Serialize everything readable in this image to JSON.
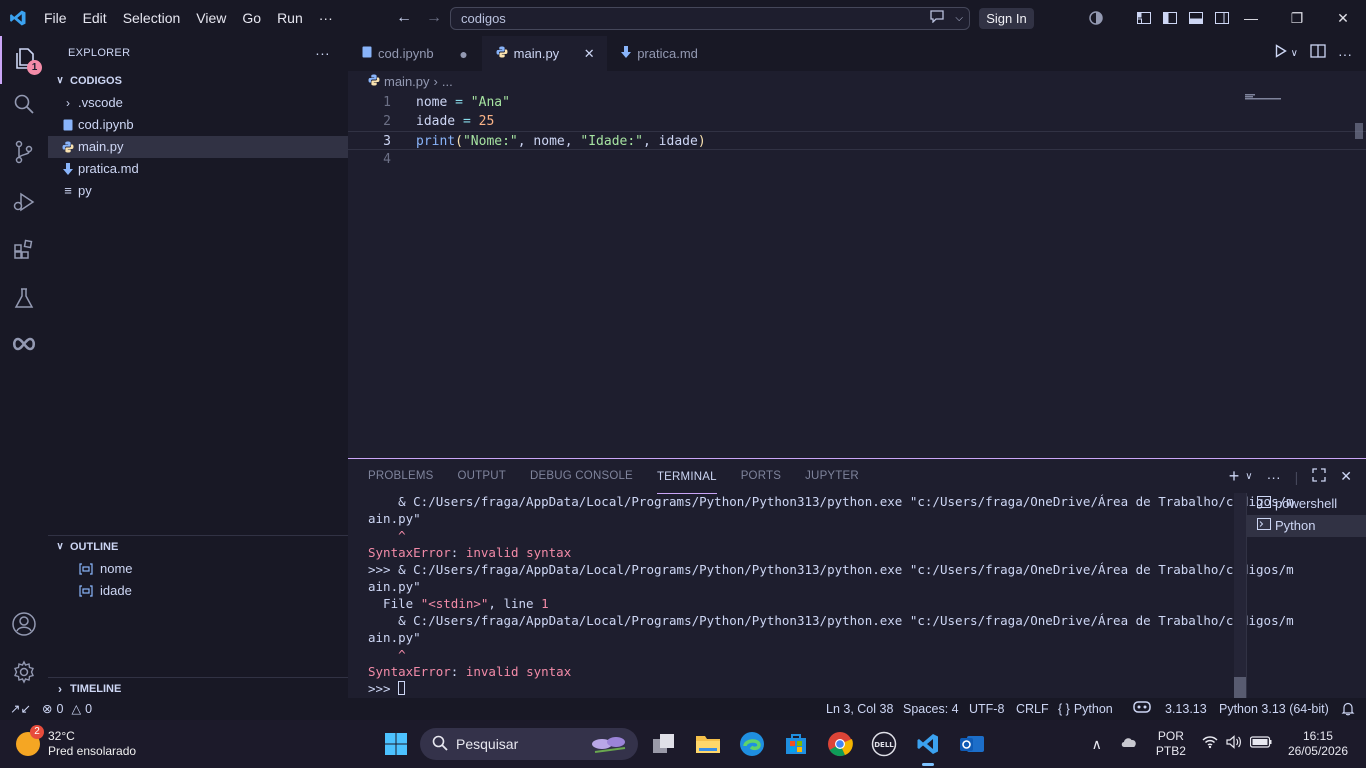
{
  "menu": [
    "File",
    "Edit",
    "Selection",
    "View",
    "Go",
    "Run",
    "···"
  ],
  "command_center": {
    "text": "codigos"
  },
  "sign_in_label": "Sign In",
  "activity": {
    "explorer_badge": "1"
  },
  "explorer": {
    "header": "EXPLORER",
    "folder": "CODIGOS",
    "items": [
      {
        "name": ".vscode",
        "icon": "chevron-right-icon"
      },
      {
        "name": "cod.ipynb",
        "icon": "notebook-icon"
      },
      {
        "name": "main.py",
        "icon": "python-icon"
      },
      {
        "name": "pratica.md",
        "icon": "markdown-icon"
      },
      {
        "name": "py",
        "icon": "file-lines-icon"
      }
    ]
  },
  "outline": {
    "title": "OUTLINE",
    "items": [
      "nome",
      "idade"
    ]
  },
  "timeline": {
    "title": "TIMELINE"
  },
  "tabs": [
    {
      "label": "cod.ipynb",
      "state": "modified"
    },
    {
      "label": "main.py",
      "state": "active"
    },
    {
      "label": "pratica.md",
      "state": "normal"
    }
  ],
  "breadcrumb": {
    "file": "main.py",
    "more": "..."
  },
  "editor": {
    "lines": [
      {
        "n": "1",
        "parts": [
          [
            "nome",
            "var"
          ],
          [
            " = ",
            "op"
          ],
          [
            "\"Ana\"",
            "str"
          ]
        ]
      },
      {
        "n": "2",
        "parts": [
          [
            "idade",
            "var"
          ],
          [
            " = ",
            "op"
          ],
          [
            "25",
            "num"
          ]
        ]
      },
      {
        "n": "3",
        "parts": [
          [
            "print",
            "fn"
          ],
          [
            "(",
            "par"
          ],
          [
            "\"Nome:\"",
            "str"
          ],
          [
            ", nome, ",
            "var"
          ],
          [
            "\"Idade:\"",
            "str"
          ],
          [
            ", idade",
            "var"
          ],
          [
            ")",
            "par"
          ]
        ]
      },
      {
        "n": "4",
        "parts": []
      }
    ]
  },
  "panel": {
    "tabs": [
      "PROBLEMS",
      "OUTPUT",
      "DEBUG CONSOLE",
      "TERMINAL",
      "PORTS",
      "JUPYTER"
    ],
    "active_tab": "TERMINAL",
    "terminal_lines": [
      [
        [
          "    & C:/Users/fraga/AppData/Local/Programs/Python/Python313/python.exe \"c:/Users/fraga/OneDrive/Área de Trabalho/codigos/m",
          ""
        ]
      ],
      [
        [
          "ain.py\"",
          ""
        ]
      ],
      [
        [
          "    ^",
          "err"
        ]
      ],
      [
        [
          "SyntaxError",
          "err"
        ],
        [
          ": ",
          ""
        ],
        [
          "invalid syntax",
          "pink"
        ]
      ],
      [
        [
          ">>> & C:/Users/fraga/AppData/Local/Programs/Python/Python313/python.exe \"c:/Users/fraga/OneDrive/Área de Trabalho/codigos/m",
          ""
        ]
      ],
      [
        [
          "ain.py\"",
          ""
        ]
      ],
      [
        [
          "  File ",
          ""
        ],
        [
          "\"<stdin>\"",
          "pink"
        ],
        [
          ", line ",
          ""
        ],
        [
          "1",
          "pink"
        ]
      ],
      [
        [
          "    & C:/Users/fraga/AppData/Local/Programs/Python/Python313/python.exe \"c:/Users/fraga/OneDrive/Área de Trabalho/codigos/m",
          ""
        ]
      ],
      [
        [
          "ain.py\"",
          ""
        ]
      ],
      [
        [
          "    ^",
          "err"
        ]
      ],
      [
        [
          "SyntaxError",
          "err"
        ],
        [
          ": ",
          ""
        ],
        [
          "invalid syntax",
          "pink"
        ]
      ],
      [
        [
          ">>> ",
          ""
        ]
      ]
    ],
    "terminals": [
      {
        "label": "powershell",
        "selected": false
      },
      {
        "label": "Python",
        "selected": true
      }
    ]
  },
  "status": {
    "errors": "0",
    "warnings": "0",
    "position": "Ln 3, Col 38",
    "spaces": "Spaces: 4",
    "encoding": "UTF-8",
    "eol": "CRLF",
    "language": "Python",
    "version": "3.13.13",
    "interpreter": "Python 3.13 (64-bit)"
  },
  "taskbar": {
    "weather_temp": "32°C",
    "weather_desc": "Pred ensolarado",
    "weather_badge": "2",
    "search_placeholder": "Pesquisar",
    "lang_top": "POR",
    "lang_bottom": "PTB2",
    "time": "16:15",
    "date": "26/05/2026"
  },
  "colors": {
    "accent": "#cba6f7",
    "background": "#1e1e2e",
    "sidebar": "#181825",
    "error": "#f38ba8"
  }
}
